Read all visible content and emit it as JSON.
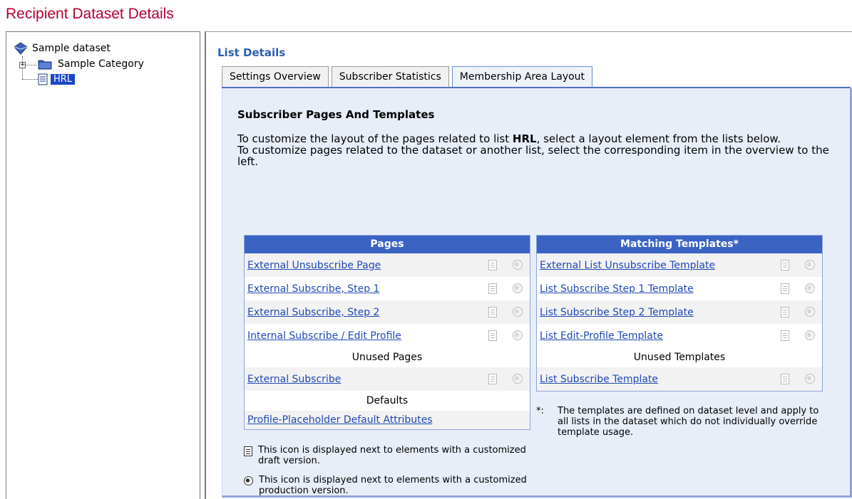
{
  "page": {
    "title": "Recipient Dataset Details"
  },
  "tree": {
    "root_label": "Sample dataset",
    "category_label": "Sample Category",
    "selected_label": "HRL"
  },
  "main": {
    "section_title": "List Details",
    "tabs": [
      {
        "label": "Settings Overview"
      },
      {
        "label": "Subscriber Statistics"
      },
      {
        "label": "Membership Area Layout"
      }
    ],
    "heading": "Subscriber Pages And Templates",
    "intro_line1_before": "To customize the layout of the pages related to list ",
    "intro_line1_bold": "HRL",
    "intro_line1_after": ", select a layout element from the lists below.",
    "intro_line2": "To customize pages related to the dataset or another list, select the corresponding item in the overview to the left."
  },
  "pages_table": {
    "header": "Pages",
    "rows": [
      {
        "label": "External Unsubscribe Page"
      },
      {
        "label": "External Subscribe, Step 1"
      },
      {
        "label": "External Subscribe, Step 2"
      },
      {
        "label": "Internal Subscribe / Edit Profile"
      }
    ],
    "unused_header": "Unused Pages",
    "unused_rows": [
      {
        "label": "External Subscribe"
      }
    ],
    "defaults_header": "Defaults",
    "defaults_rows": [
      {
        "label": "Profile-Placeholder Default Attributes"
      }
    ]
  },
  "templates_table": {
    "header": "Matching Templates*",
    "rows": [
      {
        "label": "External List Unsubscribe Template"
      },
      {
        "label": "List Subscribe Step 1 Template"
      },
      {
        "label": "List Subscribe Step 2 Template"
      },
      {
        "label": "List Edit-Profile Template"
      }
    ],
    "unused_header": "Unused Templates",
    "unused_rows": [
      {
        "label": "List Subscribe Template"
      }
    ]
  },
  "legend": {
    "draft": "This icon is displayed next to elements with a customized draft version.",
    "production": "This icon is displayed next to elements with a customized production version."
  },
  "footnote": {
    "mark": "*:",
    "text": "The templates are defined on dataset level and apply to all lists in the dataset which do not individually override template usage."
  }
}
